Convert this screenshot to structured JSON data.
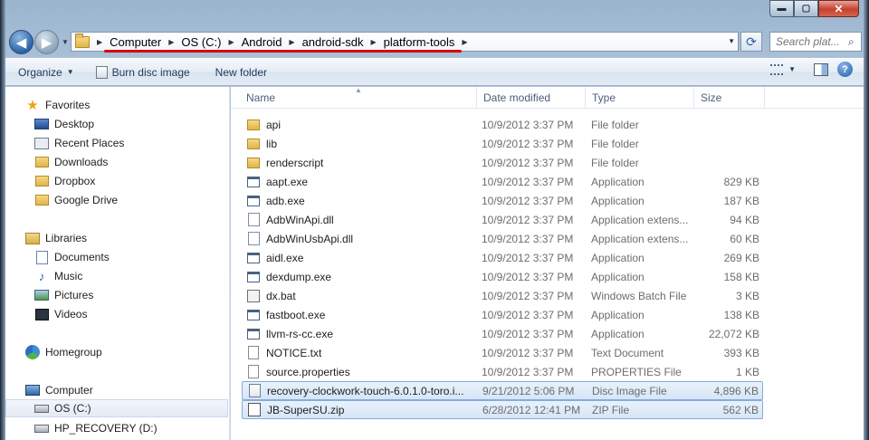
{
  "window": {
    "caption_buttons": {
      "minimize": "▬",
      "maximize": "▢",
      "close": "✕"
    }
  },
  "address_bar": {
    "crumbs": [
      "Computer",
      "OS (C:)",
      "Android",
      "android-sdk",
      "platform-tools"
    ],
    "highlight_color": "#d70000"
  },
  "search": {
    "placeholder": "Search plat..."
  },
  "toolbar": {
    "organize": "Organize",
    "burn": "Burn disc image",
    "new_folder": "New folder"
  },
  "nav": {
    "favorites": {
      "label": "Favorites",
      "items": [
        "Desktop",
        "Recent Places",
        "Downloads",
        "Dropbox",
        "Google Drive"
      ]
    },
    "libraries": {
      "label": "Libraries",
      "items": [
        "Documents",
        "Music",
        "Pictures",
        "Videos"
      ]
    },
    "homegroup": "Homegroup",
    "computer": {
      "label": "Computer",
      "items": [
        "OS (C:)",
        "HP_RECOVERY (D:)"
      ]
    }
  },
  "columns": {
    "name": "Name",
    "date": "Date modified",
    "type": "Type",
    "size": "Size"
  },
  "files": [
    {
      "icon": "folder-icon",
      "name": "api",
      "date": "10/9/2012 3:37 PM",
      "type": "File folder",
      "size": ""
    },
    {
      "icon": "folder-icon",
      "name": "lib",
      "date": "10/9/2012 3:37 PM",
      "type": "File folder",
      "size": ""
    },
    {
      "icon": "folder-icon",
      "name": "renderscript",
      "date": "10/9/2012 3:37 PM",
      "type": "File folder",
      "size": ""
    },
    {
      "icon": "application-icon",
      "name": "aapt.exe",
      "date": "10/9/2012 3:37 PM",
      "type": "Application",
      "size": "829 KB"
    },
    {
      "icon": "application-icon",
      "name": "adb.exe",
      "date": "10/9/2012 3:37 PM",
      "type": "Application",
      "size": "187 KB"
    },
    {
      "icon": "dll-icon",
      "name": "AdbWinApi.dll",
      "date": "10/9/2012 3:37 PM",
      "type": "Application extens...",
      "size": "94 KB"
    },
    {
      "icon": "dll-icon",
      "name": "AdbWinUsbApi.dll",
      "date": "10/9/2012 3:37 PM",
      "type": "Application extens...",
      "size": "60 KB"
    },
    {
      "icon": "application-icon",
      "name": "aidl.exe",
      "date": "10/9/2012 3:37 PM",
      "type": "Application",
      "size": "269 KB"
    },
    {
      "icon": "application-icon",
      "name": "dexdump.exe",
      "date": "10/9/2012 3:37 PM",
      "type": "Application",
      "size": "158 KB"
    },
    {
      "icon": "batch-file-icon",
      "name": "dx.bat",
      "date": "10/9/2012 3:37 PM",
      "type": "Windows Batch File",
      "size": "3 KB"
    },
    {
      "icon": "application-icon",
      "name": "fastboot.exe",
      "date": "10/9/2012 3:37 PM",
      "type": "Application",
      "size": "138 KB"
    },
    {
      "icon": "application-icon",
      "name": "llvm-rs-cc.exe",
      "date": "10/9/2012 3:37 PM",
      "type": "Application",
      "size": "22,072 KB"
    },
    {
      "icon": "text-document-icon",
      "name": "NOTICE.txt",
      "date": "10/9/2012 3:37 PM",
      "type": "Text Document",
      "size": "393 KB"
    },
    {
      "icon": "text-document-icon",
      "name": "source.properties",
      "date": "10/9/2012 3:37 PM",
      "type": "PROPERTIES File",
      "size": "1 KB"
    },
    {
      "icon": "disc-image-icon",
      "name": "recovery-clockwork-touch-6.0.1.0-toro.i...",
      "date": "9/21/2012 5:06 PM",
      "type": "Disc Image File",
      "size": "4,896 KB",
      "selected": true
    },
    {
      "icon": "zip-file-icon",
      "name": "JB-SuperSU.zip",
      "date": "6/28/2012 12:41 PM",
      "type": "ZIP File",
      "size": "562 KB",
      "selected": true
    }
  ]
}
